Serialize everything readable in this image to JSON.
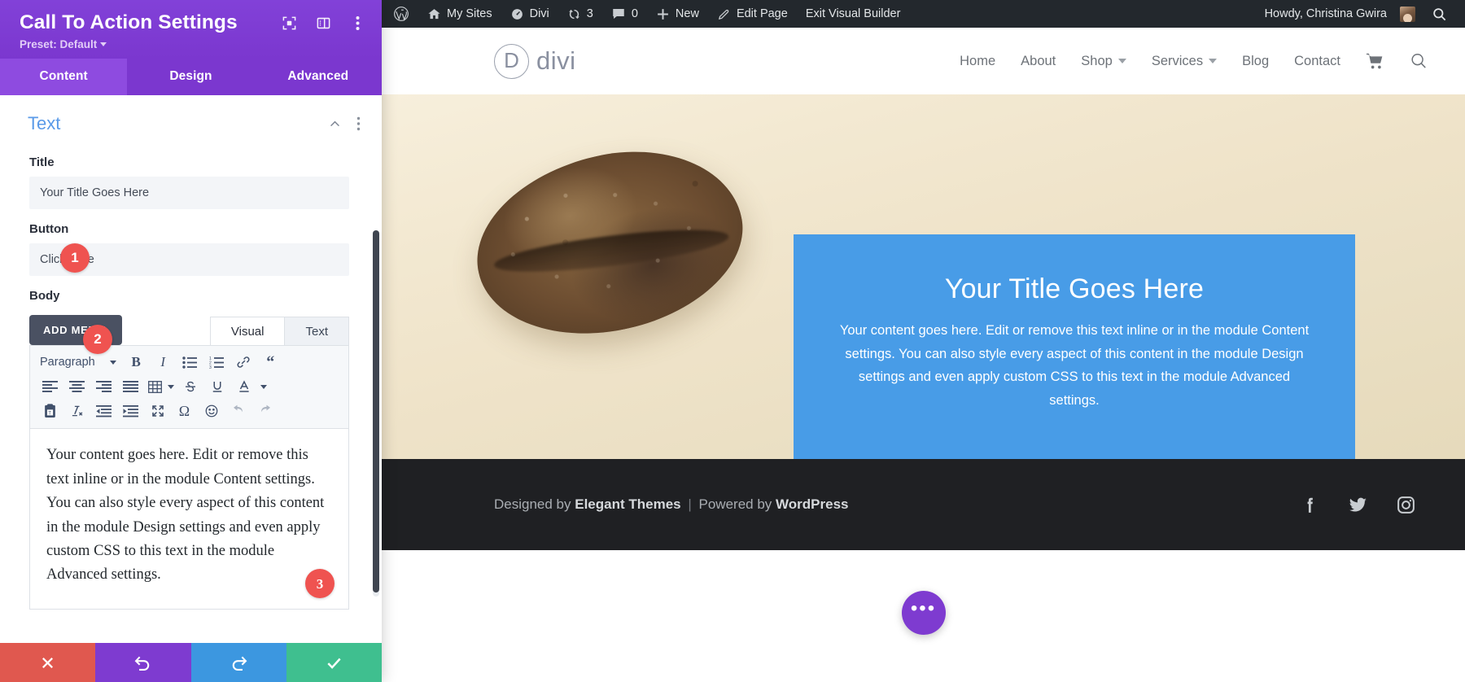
{
  "settings_panel": {
    "title": "Call To Action Settings",
    "preset_label": "Preset: Default",
    "header_icons": [
      {
        "name": "focus-mode-icon",
        "label": "Focus Mode"
      },
      {
        "name": "layout-view-icon",
        "label": "Change Layout"
      },
      {
        "name": "more-options-icon",
        "label": "More Options"
      }
    ],
    "tabs": [
      {
        "label": "Content",
        "active": true
      },
      {
        "label": "Design",
        "active": false
      },
      {
        "label": "Advanced",
        "active": false
      }
    ],
    "section": {
      "title": "Text",
      "collapse_icon": "chevron-up-icon",
      "menu_icon": "vertical-dots-icon"
    },
    "fields": {
      "title": {
        "label": "Title",
        "value": "Your Title Goes Here",
        "badge": "1"
      },
      "button": {
        "label": "Button",
        "value": "Click Here",
        "badge": "2"
      },
      "body": {
        "label": "Body",
        "add_media_label": "ADD MEDIA",
        "editor_tabs": [
          {
            "label": "Visual",
            "active": true
          },
          {
            "label": "Text",
            "active": false
          }
        ],
        "format_select": "Paragraph",
        "toolbar_row1": [
          "bold-icon",
          "italic-icon",
          "bulleted-list-icon",
          "numbered-list-icon",
          "link-icon",
          "blockquote-icon"
        ],
        "toolbar_row2": [
          "align-left-icon",
          "align-center-icon",
          "align-right-icon",
          "align-justify-icon",
          "table-icon",
          "strikethrough-icon",
          "underline-icon",
          "text-color-icon"
        ],
        "toolbar_row3": [
          "paste-as-text-icon",
          "clear-formatting-icon",
          "outdent-icon",
          "indent-icon",
          "fullscreen-icon",
          "special-character-icon",
          "emoji-icon",
          "undo-icon",
          "redo-icon"
        ],
        "content": "Your content goes here. Edit or remove this text inline or in the module Content settings. You can also style every aspect of this content in the module Design settings and even apply custom CSS to this text in the module Advanced settings.",
        "badge": "3"
      }
    },
    "footer_buttons": [
      {
        "name": "discard-button",
        "icon": "close-icon",
        "color": "#e0584f"
      },
      {
        "name": "undo-button",
        "icon": "undo-icon",
        "color": "#7E3BD0"
      },
      {
        "name": "redo-button",
        "icon": "redo-icon",
        "color": "#3c97e0"
      },
      {
        "name": "save-button",
        "icon": "check-icon",
        "color": "#3fbf8f"
      }
    ]
  },
  "admin_bar": {
    "items": [
      {
        "name": "wordpress-logo-icon",
        "label": "",
        "icon": "wordpress-icon"
      },
      {
        "name": "my-sites-menu",
        "label": "My Sites",
        "icon": "sites-icon"
      },
      {
        "name": "divi-menu",
        "label": "Divi",
        "icon": "divi-dashboard-icon"
      },
      {
        "name": "updates-menu",
        "label": "3",
        "icon": "updates-icon"
      },
      {
        "name": "comments-menu",
        "label": "0",
        "icon": "comment-icon"
      },
      {
        "name": "new-content-menu",
        "label": "New",
        "icon": "plus-icon"
      },
      {
        "name": "edit-page-link",
        "label": "Edit Page",
        "icon": "pencil-icon"
      },
      {
        "name": "exit-visual-builder-link",
        "label": "Exit Visual Builder",
        "icon": ""
      }
    ],
    "howdy": "Howdy, Christina Gwira",
    "search_icon": "search-icon"
  },
  "site": {
    "logo": {
      "mark": "D",
      "text": "divi"
    },
    "nav": [
      {
        "label": "Home",
        "has_dropdown": false
      },
      {
        "label": "About",
        "has_dropdown": false
      },
      {
        "label": "Shop",
        "has_dropdown": true
      },
      {
        "label": "Services",
        "has_dropdown": true
      },
      {
        "label": "Blog",
        "has_dropdown": false
      },
      {
        "label": "Contact",
        "has_dropdown": false
      }
    ],
    "nav_icons": [
      "cart-icon",
      "search-icon"
    ],
    "hero_image_alt": "bread-loaf-image",
    "cta": {
      "title": "Your Title Goes Here",
      "body": "Your content goes here. Edit or remove this text inline or in the module Content settings. You can also style every aspect of this content in the module Design settings and even apply custom CSS to this text in the module Advanced settings.",
      "bg_color": "#489ce7"
    },
    "footer": {
      "designed_by_prefix": "Designed by",
      "designed_by": "Elegant Themes",
      "separator": "|",
      "powered_by_prefix": "Powered by",
      "powered_by": "WordPress",
      "social": [
        "facebook-icon",
        "twitter-icon",
        "instagram-icon"
      ]
    },
    "fab": {
      "name": "visual-builder-menu-button",
      "glyph": "•••",
      "color": "#7E3BD0"
    }
  },
  "colors": {
    "panel_purple": "#7E3BD0",
    "tab_active": "#8e4be0",
    "badge_red": "#ef5350",
    "section_blue": "#5a9ae8",
    "cta_blue": "#489ce7",
    "adminbar": "#23282d"
  }
}
